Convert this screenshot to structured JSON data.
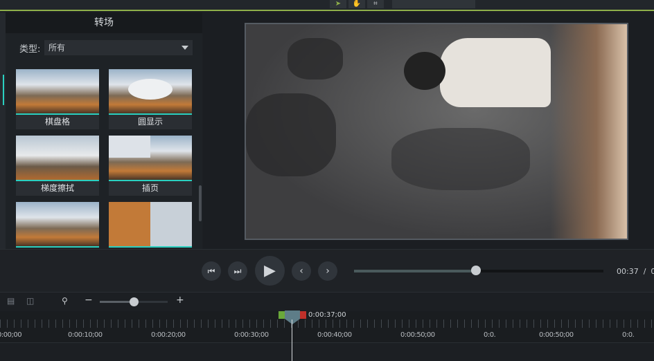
{
  "panel": {
    "title": "转场",
    "type_label": "类型:",
    "type_value": "所有"
  },
  "transitions": [
    {
      "label": "棋盘格"
    },
    {
      "label": "圆显示"
    },
    {
      "label": "梯度擦拭"
    },
    {
      "label": "插页"
    },
    {
      "label": ""
    },
    {
      "label": ""
    }
  ],
  "playback": {
    "current_time": "00:37",
    "separator": "/",
    "total_time": "0:",
    "progress_percent": 49
  },
  "timeline": {
    "playhead_time": "0:00:37;00",
    "ruler_labels": [
      "0:00;00",
      "0:00:10;00",
      "0:00:20;00",
      "0:00:30;00",
      "0:00:40;00",
      "0:00:50;00",
      "0:0.",
      "0:00:50;00",
      "0:0."
    ]
  },
  "colors": {
    "accent": "#2ad0c0",
    "top_line": "#8fb04a",
    "in_marker": "#6aa83a",
    "out_marker": "#c0302a"
  }
}
